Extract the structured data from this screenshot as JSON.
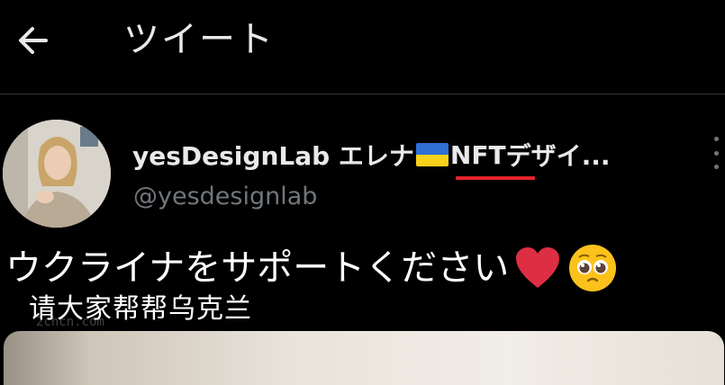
{
  "header": {
    "title": "ツイート",
    "back_icon": "arrow-left-icon"
  },
  "author": {
    "display_name_prefix": "yesDesignLab エレナ",
    "display_name_highlight": "NFT",
    "display_name_suffix": "デザイ...",
    "handle": "@yesdesignlab",
    "flag": "ukraine-flag-emoji",
    "colors": {
      "flag_blue": "#2f6fd6",
      "flag_yellow": "#f7d21a",
      "underline": "#e3242b"
    }
  },
  "tweet": {
    "text": "ウクライナをサポートください",
    "emojis": [
      "red-heart-emoji",
      "pleading-face-emoji"
    ]
  },
  "overlay": {
    "caption": "请大家帮帮乌克兰",
    "watermark": "2chcn.com"
  }
}
